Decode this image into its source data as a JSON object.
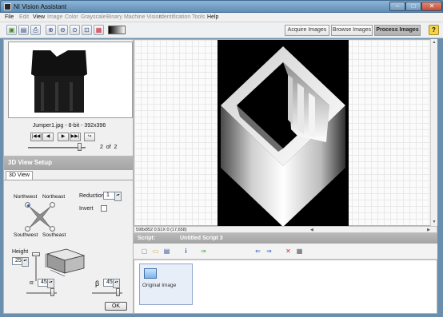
{
  "window": {
    "title": "NI Vision Assistant",
    "controls": {
      "minimize": "–",
      "maximize": "□",
      "close": "✕"
    }
  },
  "menu": [
    {
      "label": "File",
      "enabled": true
    },
    {
      "label": "Edit",
      "enabled": false
    },
    {
      "label": "View",
      "enabled": true
    },
    {
      "label": "Image",
      "enabled": false
    },
    {
      "label": "Color",
      "enabled": false
    },
    {
      "label": "Grayscale",
      "enabled": false
    },
    {
      "label": "Binary",
      "enabled": false
    },
    {
      "label": "Machine Vision",
      "enabled": false
    },
    {
      "label": "Identification",
      "enabled": false
    },
    {
      "label": "Tools",
      "enabled": false
    },
    {
      "label": "Help",
      "enabled": true
    }
  ],
  "toolbar": {
    "icons": [
      "acquire-icon",
      "save-icon",
      "print-icon",
      "zoom-in-icon",
      "zoom-out-icon",
      "zoom-1to1-icon",
      "zoom-fit-icon",
      "color-palette-icon"
    ],
    "mode_tabs": {
      "acquire": "Acquire Images",
      "browse": "Browse Images",
      "process": "Process Images"
    },
    "help": "?"
  },
  "left": {
    "thumbnail_caption": "Jumper1.jpg - 8-bit - 392x396",
    "nav": {
      "first": "|◀◀",
      "prev": "◀",
      "next": "▶",
      "last": "▶▶|",
      "close": "↪"
    },
    "page": {
      "current": "2",
      "of": "of",
      "total": "2"
    },
    "setup_title": "3D View Setup",
    "tab": "3D View",
    "directions": {
      "northwest": "Northwest",
      "northeast": "Northeast",
      "southwest": "Southwest",
      "southeast": "Southeast",
      "selected": "northwest"
    },
    "reduction_label": "Reduction",
    "reduction_value": "1",
    "invert_label": "Invert",
    "invert_checked": false,
    "height_label": "Height",
    "height_value": "255",
    "alpha_label": "α:",
    "alpha_value": "45",
    "beta_label": "β",
    "beta_value": "45",
    "ok": "OK"
  },
  "image_view": {
    "status": "598x852 0.51X 0      (17,658)"
  },
  "script": {
    "label": "Script:",
    "name": "Untitled Script 3",
    "steps": [
      {
        "label": "Original Image"
      }
    ],
    "toolbar_icons": [
      "new-script-icon",
      "open-script-icon",
      "save-script-icon",
      "info-icon",
      "run-script-icon",
      "move-left-icon",
      "move-right-icon",
      "delete-step-icon",
      "properties-icon"
    ]
  },
  "colors": {
    "accent": "#4a74b4",
    "header_gray": "#aaaaaa",
    "title_blue": "#6f9bc3"
  }
}
